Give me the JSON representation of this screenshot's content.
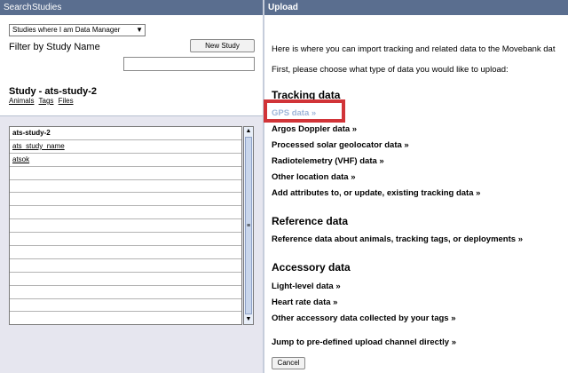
{
  "left_nav": {
    "search": "Search",
    "studies": "Studies"
  },
  "study_filter": {
    "selected_option": "Studies where I am Data Manager",
    "new_study_label": "New Study",
    "filter_label": "Filter by Study Name",
    "filter_value": ""
  },
  "study": {
    "title": "Study - ats-study-2",
    "links": [
      "Animals",
      "Tags",
      "Files"
    ]
  },
  "study_table": {
    "rows": [
      "ats-study-2",
      "ats_study_name",
      "atsok",
      "",
      "",
      "",
      "",
      "",
      "",
      "",
      "",
      "",
      "",
      "",
      ""
    ]
  },
  "scrollbar": {
    "up": "▲",
    "grip": "≡",
    "down": "▼"
  },
  "upload": {
    "title": "Upload",
    "intro_1": "Here is where you can import tracking and related data to the Movebank dat",
    "intro_2": "First, please choose what type of data you would like to upload:",
    "tracking_heading": "Tracking data",
    "tracking_items": [
      "GPS data »",
      "Argos Doppler data »",
      "Processed solar geolocator data »",
      "Radiotelemetry (VHF) data »",
      "Other location data »",
      "Add attributes to, or update, existing tracking data »"
    ],
    "reference_heading": "Reference data",
    "reference_items": [
      "Reference data about animals, tracking tags, or deployments »"
    ],
    "accessory_heading": "Accessory data",
    "accessory_items": [
      "Light-level data »",
      "Heart rate data »",
      "Other accessory data collected by your tags »"
    ],
    "jump_link": "Jump to pre-defined upload channel directly »",
    "cancel_label": "Cancel"
  },
  "colors": {
    "header_bar": "#5a6e8f",
    "highlight": "#d13438",
    "gps_link": "#9fb6d8"
  }
}
